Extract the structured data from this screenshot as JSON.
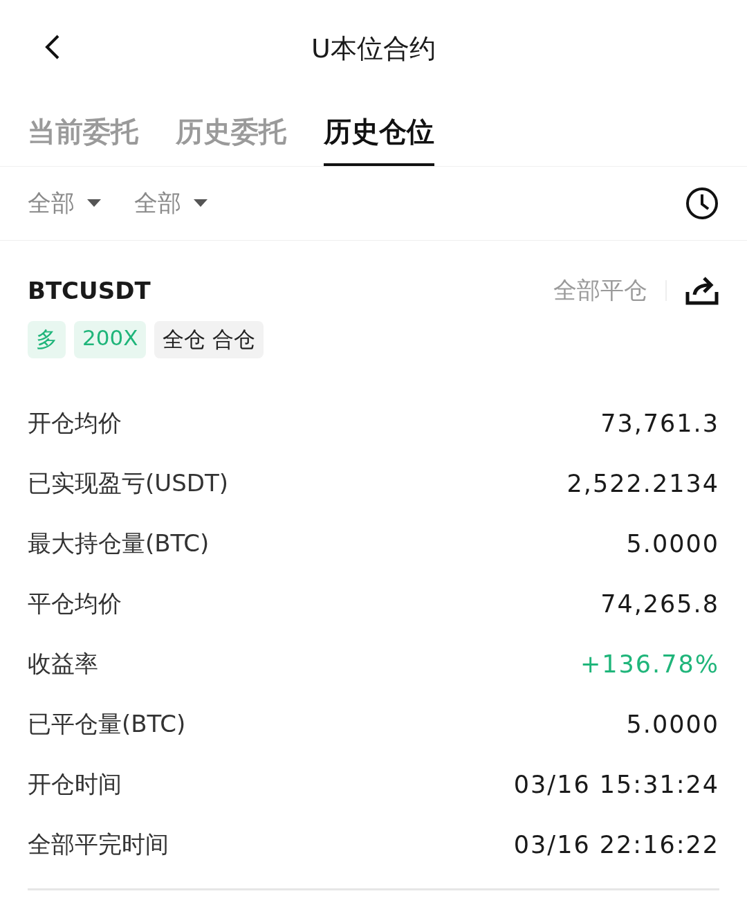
{
  "header": {
    "title": "U本位合约"
  },
  "tabs": [
    {
      "label": "当前委托",
      "selected": false
    },
    {
      "label": "历史委托",
      "selected": false
    },
    {
      "label": "历史仓位",
      "selected": true
    }
  ],
  "filters": [
    {
      "label": "全部"
    },
    {
      "label": "全部"
    }
  ],
  "position": {
    "symbol": "BTCUSDT",
    "action": "全部平仓",
    "tags": [
      {
        "label": "多",
        "kind": "accent"
      },
      {
        "label": "200X",
        "kind": "accent"
      },
      {
        "label": "全仓 合仓",
        "kind": "neutral"
      }
    ],
    "rows": [
      {
        "label": "开仓均价",
        "value": "73,761.3",
        "kind": "plain"
      },
      {
        "label": "已实现盈亏(USDT)",
        "value": "2,522.2134",
        "kind": "plain"
      },
      {
        "label": "最大持仓量(BTC)",
        "value": "5.0000",
        "kind": "plain"
      },
      {
        "label": "平仓均价",
        "value": "74,265.8",
        "kind": "plain"
      },
      {
        "label": "收益率",
        "value": "+136.78%",
        "kind": "gain"
      },
      {
        "label": "已平仓量(BTC)",
        "value": "5.0000",
        "kind": "plain"
      },
      {
        "label": "开仓时间",
        "value": "03/16 15:31:24",
        "kind": "plain"
      },
      {
        "label": "全部平完时间",
        "value": "03/16 22:16:22",
        "kind": "plain"
      }
    ]
  }
}
